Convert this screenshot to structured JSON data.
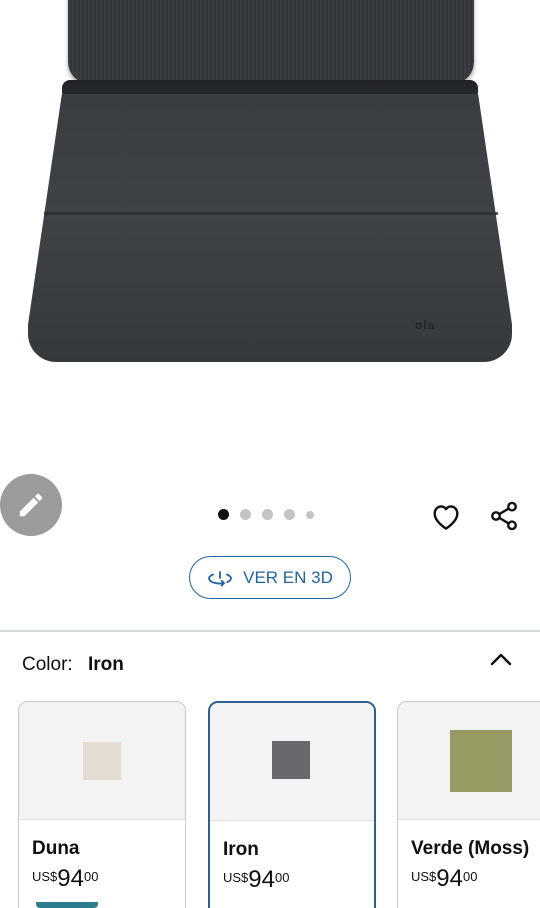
{
  "product_image": {
    "brand_mark": "alo"
  },
  "actions": {
    "edit_icon": "pencil-icon",
    "wishlist_icon": "heart-icon",
    "share_icon": "share-icon"
  },
  "carousel": {
    "total": 5,
    "active_index": 0
  },
  "view_3d": {
    "label": "VER EN 3D",
    "icon": "rotate-3d-icon"
  },
  "color_selector": {
    "label": "Color:",
    "selected": "Iron",
    "expanded": true
  },
  "swatches": [
    {
      "name": "Duna",
      "currency": "US$",
      "whole": "94",
      "fraction": "00",
      "color": "#e4dbd1",
      "selected": false
    },
    {
      "name": "Iron",
      "currency": "US$",
      "whole": "94",
      "fraction": "00",
      "color": "#66686c",
      "selected": true
    },
    {
      "name": "Verde (Moss)",
      "currency": "US$",
      "whole": "94",
      "fraction": "00",
      "color": "#979b63",
      "selected": false
    }
  ],
  "colors": {
    "link_blue": "#2162a1",
    "selected_border": "#2d5f8e",
    "fab_gray": "#9b9b9b"
  }
}
